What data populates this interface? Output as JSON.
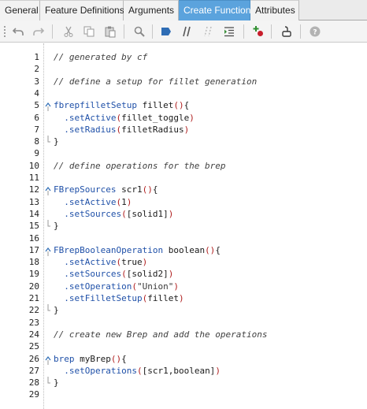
{
  "tabs": [
    {
      "label": "General",
      "active": false
    },
    {
      "label": "Feature Definitions",
      "active": false
    },
    {
      "label": "Arguments",
      "active": false
    },
    {
      "label": "Create Function",
      "active": true
    },
    {
      "label": "Attributes",
      "active": false
    }
  ],
  "toolbar": {
    "buttons": [
      "undo",
      "redo",
      "cut",
      "copy",
      "paste",
      "find",
      "bookmark",
      "comment",
      "uncomment",
      "indent",
      "add-breakpoint",
      "run",
      "help"
    ]
  },
  "colors": {
    "active_tab": "#5ba3dd",
    "keyword_type": "#1f50a8",
    "paren": "#b01f1f"
  },
  "code": {
    "lines": [
      {
        "n": "1",
        "text": "// generated by cf"
      },
      {
        "n": "2",
        "text": ""
      },
      {
        "n": "3",
        "text": "// define a setup for fillet generation"
      },
      {
        "n": "4",
        "text": ""
      },
      {
        "n": "5",
        "text": "fbrepfilletSetup fillet(){"
      },
      {
        "n": "6",
        "text": "  .setActive(fillet_toggle)"
      },
      {
        "n": "7",
        "text": "  .setRadius(filletRadius)"
      },
      {
        "n": "8",
        "text": "}"
      },
      {
        "n": "9",
        "text": ""
      },
      {
        "n": "10",
        "text": "// define operations for the brep"
      },
      {
        "n": "11",
        "text": ""
      },
      {
        "n": "12",
        "text": "FBrepSources scr1(){"
      },
      {
        "n": "13",
        "text": "  .setActive(1)"
      },
      {
        "n": "14",
        "text": "  .setSources([solid1])"
      },
      {
        "n": "15",
        "text": "}"
      },
      {
        "n": "16",
        "text": ""
      },
      {
        "n": "17",
        "text": "FBrepBooleanOperation boolean(){"
      },
      {
        "n": "18",
        "text": "  .setActive(true)"
      },
      {
        "n": "19",
        "text": "  .setSources([solid2])"
      },
      {
        "n": "20",
        "text": "  .setOperation(\"Union\")"
      },
      {
        "n": "21",
        "text": "  .setFilletSetup(fillet)"
      },
      {
        "n": "22",
        "text": "}"
      },
      {
        "n": "23",
        "text": ""
      },
      {
        "n": "24",
        "text": "// create new Brep and add the operations"
      },
      {
        "n": "25",
        "text": ""
      },
      {
        "n": "26",
        "text": "brep myBrep(){"
      },
      {
        "n": "27",
        "text": "  .setOperations([scr1,boolean])"
      },
      {
        "n": "28",
        "text": "}"
      },
      {
        "n": "29",
        "text": ""
      }
    ]
  }
}
